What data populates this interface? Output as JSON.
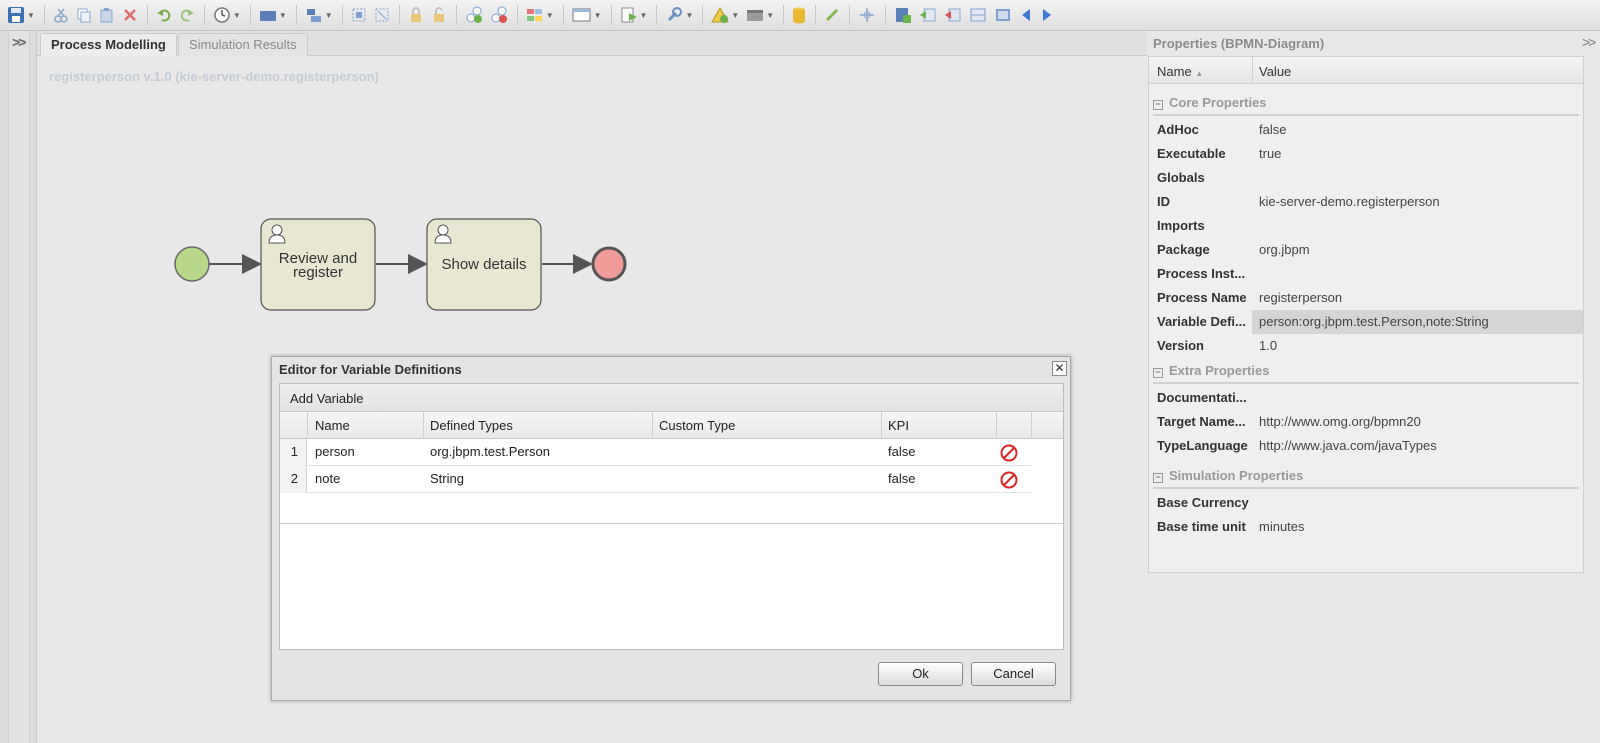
{
  "toolbar": {
    "icons": [
      "save-icon",
      "cut-icon",
      "copy-icon",
      "paste-icon",
      "delete-icon",
      "undo-icon",
      "redo-icon",
      "history-icon",
      "shape-icon",
      "align-icon",
      "select-all-icon",
      "deselect-icon",
      "lock-icon",
      "unlock-icon",
      "add-node-icon",
      "remove-node-icon",
      "color-icon",
      "layout-icon",
      "export-icon",
      "tools-icon",
      "validate-icon",
      "archive-icon",
      "database-icon",
      "pen-icon",
      "move-icon",
      "new-icon",
      "zoom-in-icon",
      "zoom-out-icon",
      "view-icon",
      "fit-icon",
      "prev-icon",
      "next-icon"
    ]
  },
  "tabs": [
    {
      "label": "Process Modelling",
      "active": true
    },
    {
      "label": "Simulation Results",
      "active": false
    }
  ],
  "canvas": {
    "title": "registerperson v.1.0 (kie-server-demo.registerperson)",
    "tasks": [
      {
        "label_line1": "Review and",
        "label_line2": "register"
      },
      {
        "label_line1": "Show details",
        "label_line2": ""
      }
    ]
  },
  "properties": {
    "title": "Properties (BPMN-Diagram)",
    "col_name": "Name",
    "col_value": "Value",
    "groups": [
      {
        "title": "Core Properties",
        "rows": [
          {
            "name": "AdHoc",
            "value": "false"
          },
          {
            "name": "Executable",
            "value": "true"
          },
          {
            "name": "Globals",
            "value": ""
          },
          {
            "name": "ID",
            "value": "kie-server-demo.registerperson"
          },
          {
            "name": "Imports",
            "value": ""
          },
          {
            "name": "Package",
            "value": "org.jbpm"
          },
          {
            "name": "Process Inst...",
            "value": ""
          },
          {
            "name": "Process Name",
            "value": "registerperson"
          },
          {
            "name": "Variable Defi...",
            "value": "person:org.jbpm.test.Person,note:String"
          },
          {
            "name": "Version",
            "value": "1.0"
          }
        ]
      },
      {
        "title": "Extra Properties",
        "rows": [
          {
            "name": "Documentati...",
            "value": ""
          },
          {
            "name": "Target Name...",
            "value": "http://www.omg.org/bpmn20"
          },
          {
            "name": "TypeLanguage",
            "value": "http://www.java.com/javaTypes"
          }
        ]
      },
      {
        "title": "Simulation Properties",
        "rows": [
          {
            "name": "Base Currency",
            "value": ""
          },
          {
            "name": "Base time unit",
            "value": "minutes"
          }
        ]
      }
    ]
  },
  "dialog": {
    "title": "Editor for Variable Definitions",
    "add_label": "Add Variable",
    "columns": [
      "Name",
      "Defined Types",
      "Custom Type",
      "KPI"
    ],
    "rows": [
      {
        "num": "1",
        "name": "person",
        "defined_type": "org.jbpm.test.Person",
        "custom_type": "",
        "kpi": "false"
      },
      {
        "num": "2",
        "name": "note",
        "defined_type": "String",
        "custom_type": "",
        "kpi": "false"
      }
    ],
    "ok_label": "Ok",
    "cancel_label": "Cancel"
  }
}
